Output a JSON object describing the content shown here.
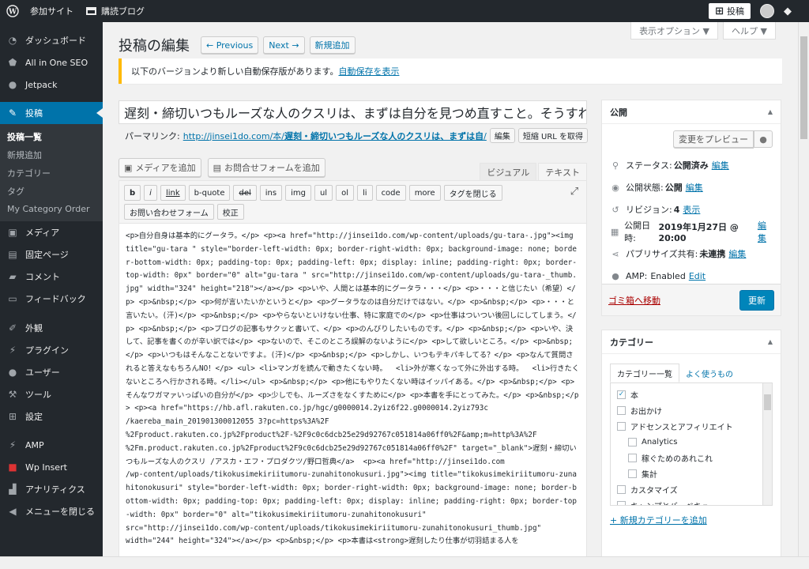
{
  "adminbar": {
    "wp_logo": "wordpress-icon",
    "site_label": "参加サイト",
    "reader_label": "購読ブログ",
    "new_post_label": "投稿"
  },
  "sidebar": {
    "items": [
      {
        "label": "ダッシュボード",
        "icon": "dashboard-icon"
      },
      {
        "label": "All in One SEO",
        "icon": "shield-icon"
      },
      {
        "label": "Jetpack",
        "icon": "jetpack-icon"
      },
      {
        "label": "投稿",
        "icon": "pin-icon"
      },
      {
        "label": "メディア",
        "icon": "media-icon"
      },
      {
        "label": "固定ページ",
        "icon": "page-icon"
      },
      {
        "label": "コメント",
        "icon": "comment-icon"
      },
      {
        "label": "フィードバック",
        "icon": "feedback-icon"
      },
      {
        "label": "外観",
        "icon": "brush-icon"
      },
      {
        "label": "プラグイン",
        "icon": "plugin-icon"
      },
      {
        "label": "ユーザー",
        "icon": "user-icon"
      },
      {
        "label": "ツール",
        "icon": "wrench-icon"
      },
      {
        "label": "設定",
        "icon": "settings-icon"
      },
      {
        "label": "AMP",
        "icon": "amp-icon"
      },
      {
        "label": "Wp Insert",
        "icon": "wp-insert-icon"
      },
      {
        "label": "アナリティクス",
        "icon": "analytics-icon"
      },
      {
        "label": "メニューを閉じる",
        "icon": "collapse-icon"
      }
    ],
    "submenu": [
      "投稿一覧",
      "新規追加",
      "カテゴリー",
      "タグ",
      "My Category Order"
    ]
  },
  "screen_options": {
    "display": "表示オプション ▼",
    "help": "ヘルプ ▼"
  },
  "header": {
    "title": "投稿の編集",
    "prev": "← Previous",
    "next": "Next →",
    "add_new": "新規追加"
  },
  "notice": {
    "text": "以下のバージョンより新しい自動保存版があります。",
    "link": "自動保存を表示"
  },
  "post": {
    "title": "遅刻・締切いつもルーズな人のクスリは、まずは自分を見つめ直すこと。そうすれ",
    "permalink_label": "パーマリンク:",
    "permalink_base": "http://jinsei1do.com/本/",
    "permalink_slug": "遅刻・締切いつもルーズな人のクスリは、まずは自",
    "permalink_tail": "/",
    "edit_btn": "編集",
    "shortlink_btn": "短縮 URL を取得"
  },
  "editor": {
    "add_media": "メディアを追加",
    "add_form": "お問合せフォームを追加",
    "tab_visual": "ビジュアル",
    "tab_text": "テキスト",
    "quicktags_row1": [
      "b",
      "i",
      "link",
      "b-quote",
      "del",
      "ins",
      "img",
      "ul",
      "ol",
      "li",
      "code",
      "more",
      "タグを閉じる"
    ],
    "quicktags_row2": [
      "お問い合わせフォーム",
      "校正"
    ],
    "content": "<p>自分自身は基本的にグータラ。</p> <p><a href=\"http://jinsei1do.com/wp-content/uploads/gu-tara-.jpg\"><img title=\"gu-tara \" style=\"border-left-width: 0px; border-right-width: 0px; background-image: none; border-bottom-width: 0px; padding-top: 0px; padding-left: 0px; display: inline; padding-right: 0px; border-top-width: 0px\" border=\"0\" alt=\"gu-tara \" src=\"http://jinsei1do.com/wp-content/uploads/gu-tara-_thumb.jpg\" width=\"324\" height=\"218\"></a></p> <p>いや、人間とは基本的にグータラ・・・</p> <p>・・・と信じたい（希望）</p> <p>&nbsp;</p> <p>何が言いたいかというと</p> <p>グータラなのは自分だけではない。</p> <p>&nbsp;</p> <p>・・・と言いたい。(汗)</p> <p>&nbsp;</p> <p>やらないといけない仕事、特に家庭での</p> <p>仕事はついつい後回しにしてしまう。</p> <p>&nbsp;</p> <p>ブログの記事もサクッと書いて、</p> <p>のんびりしたいものです。</p> <p>&nbsp;</p> <p>いや、決して、記事を書くのが辛い訳では</p> <p>ないので、そこのところ誤解のないように</p> <p>して欲しいところ。</p> <p>&nbsp;</p> <p>いつもはそんなことないですよ。(汗)</p> <p>&nbsp;</p> <p>しかし、いつもテキパキしてる？</p> <p>なんて質問されると答えなもちろんNO！</p> <ul> <li>マンガを読んで動きたくない時。  <li>外が寒くなって外に外出する時。  <li>行きたくないところへ行かされる時。</li></ul> <p>&nbsp;</p> <p>他にもやりたくない時はイッパイある。</p> <p>&nbsp;</p> <p>そんなワガマァいっぱいの自分が</p> <p>少しでも、ルーズさをなくすために</p> <p>本書を手にとってみた。</p> <p>&nbsp;</p> <p><a href=\"https://hb.afl.rakuten.co.jp/hgc/g0000014.2yiz6f22.g0000014.2yiz793c\n/kaereba_main_201901300012055 3?pc=https%3A%2F\n%2Fproduct.rakuten.co.jp%2Fproduct%2F-%2F9c0c6dcb25e29d92767c051814a06ff0%2F&amp;m=http%3A%2F\n%2Fm.product.rakuten.co.jp%2Fproduct%2F9c0c6dcb25e29d92767c051814a06ff0%2F\" target=\"_blank\">遅刻・締切いつもルーズな人のクスリ /アスカ・エフ・プロダクツ/野口哲典</a>  <p><a href=\"http://jinsei1do.com\n/wp-content/uploads/tikokusimekiriitumoru-zunahitonokusuri.jpg\"><img title=\"tikokusimekiriitumoru-zunahitonokusuri\" style=\"border-left-width: 0px; border-right-width: 0px; background-image: none; border-bottom-width: 0px; padding-top: 0px; padding-left: 0px; display: inline; padding-right: 0px; border-top-width: 0px\" border=\"0\" alt=\"tikokusimekiriitumoru-zunahitonokusuri\"\nsrc=\"http://jinsei1do.com/wp-content/uploads/tikokusimekiriitumoru-zunahitonokusuri_thumb.jpg\"\nwidth=\"244\" height=\"324\"></a></p> <p>&nbsp;</p> <p>本書は<strong>遅刻したり仕事が切羽詰まる人を"
  },
  "publish": {
    "title": "公開",
    "preview_btn": "変更をプレビュー",
    "status_label": "ステータス:",
    "status_value": "公開済み",
    "visibility_label": "公開状態:",
    "visibility_value": "公開",
    "revisions_label": "リビジョン:",
    "revisions_value": "4",
    "revisions_link": "表示",
    "published_label": "公開日時:",
    "published_value": "2019年1月27日 @ 20:00",
    "publicize_label": "パブリサイズ共有:",
    "publicize_value": "未連携",
    "amp_label": "AMP:",
    "amp_value": "Enabled",
    "edit_link": "編集",
    "edit_link_en": "Edit",
    "trash": "ゴミ箱へ移動",
    "update_btn": "更新"
  },
  "categories": {
    "title": "カテゴリー",
    "tab_all": "カテゴリー一覧",
    "tab_popular": "よく使うもの",
    "items": [
      {
        "label": "本",
        "checked": true,
        "child": false
      },
      {
        "label": "お出かけ",
        "checked": false,
        "child": false
      },
      {
        "label": "アドセンスとアフィリエイト",
        "checked": false,
        "child": false
      },
      {
        "label": "Analytics",
        "checked": false,
        "child": true
      },
      {
        "label": "稼ぐためのあれこれ",
        "checked": false,
        "child": true
      },
      {
        "label": "集計",
        "checked": false,
        "child": true
      },
      {
        "label": "カスタマイズ",
        "checked": false,
        "child": false
      },
      {
        "label": "キャンプとバーベキュー",
        "checked": false,
        "child": false
      }
    ],
    "add_new": "+ 新規カテゴリーを追加"
  },
  "colors": {
    "admin_bg": "#23282d",
    "accent": "#0073aa",
    "primary": "#0085ba",
    "notice": "#ffb900"
  }
}
